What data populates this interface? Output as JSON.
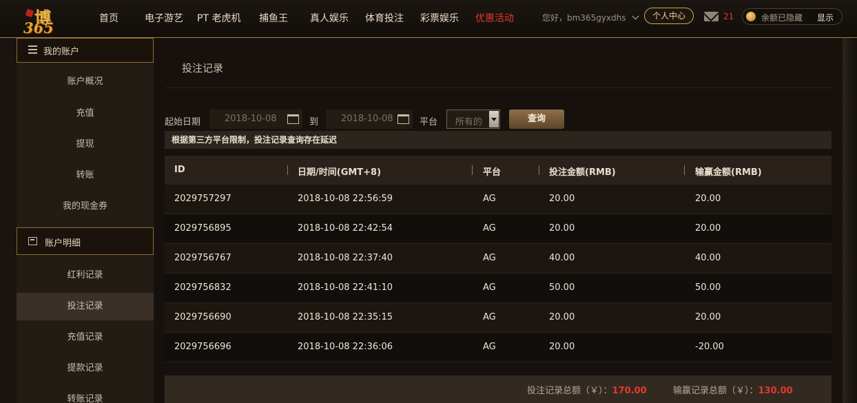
{
  "logo": {
    "main": "博",
    "sub": "365"
  },
  "nav": {
    "items": [
      {
        "label": "首页",
        "active": false
      },
      {
        "label": "电子游艺",
        "active": false
      },
      {
        "label": "PT 老虎机",
        "active": false
      },
      {
        "label": "捕鱼王",
        "active": false
      },
      {
        "label": "真人娱乐",
        "active": false
      },
      {
        "label": "体育投注",
        "active": false
      },
      {
        "label": "彩票娱乐",
        "active": false
      },
      {
        "label": "优惠活动",
        "active": true
      }
    ]
  },
  "user": {
    "greeting": "您好，bm365gyxdhs",
    "personal_center": "个人中心",
    "mail_count": "21",
    "balance_hidden": "余额已隐藏",
    "show_label": "显示"
  },
  "sidebar": {
    "section1": {
      "title": "我的账户",
      "icon": "wallet-card-icon"
    },
    "section1_items": [
      "账户概况",
      "充值",
      "提现",
      "转账",
      "我的现金券"
    ],
    "section2": {
      "title": "账户明细",
      "icon": "calculator-icon"
    },
    "section2_items": [
      "红利记录",
      "投注记录",
      "充值记录",
      "提款记录",
      "转账记录"
    ],
    "active_item": "投注记录"
  },
  "page": {
    "title": "投注记录",
    "filters": {
      "start_label": "起始日期",
      "start_value": "2018-10-08",
      "to_label": "到",
      "end_value": "2018-10-08",
      "platform_label": "平台",
      "platform_value": "所有的",
      "query_label": "查询"
    },
    "notice": "根据第三方平台限制，投注记录查询存在延迟"
  },
  "table": {
    "headers": [
      "ID",
      "日期/时间(GMT+8)",
      "平台",
      "投注金额(RMB)",
      "输赢金额(RMB)"
    ],
    "rows": [
      [
        "2029757297",
        "2018-10-08 22:56:59",
        "AG",
        "20.00",
        "20.00"
      ],
      [
        "2029756895",
        "2018-10-08 22:42:54",
        "AG",
        "20.00",
        "20.00"
      ],
      [
        "2029756767",
        "2018-10-08 22:37:40",
        "AG",
        "40.00",
        "40.00"
      ],
      [
        "2029756832",
        "2018-10-08 22:41:10",
        "AG",
        "50.00",
        "50.00"
      ],
      [
        "2029756690",
        "2018-10-08 22:35:15",
        "AG",
        "20.00",
        "20.00"
      ],
      [
        "2029756696",
        "2018-10-08 22:36:06",
        "AG",
        "20.00",
        "-20.00"
      ]
    ]
  },
  "summary": {
    "bet_total_label": "投注记录总额（￥）：",
    "bet_total_value": "170.00",
    "win_total_label": "输赢记录总额（￥）：",
    "win_total_value": "130.00"
  },
  "colors": {
    "accent_gold": "#d2a84d",
    "active_red": "#e2392d",
    "background": "#16110d"
  }
}
